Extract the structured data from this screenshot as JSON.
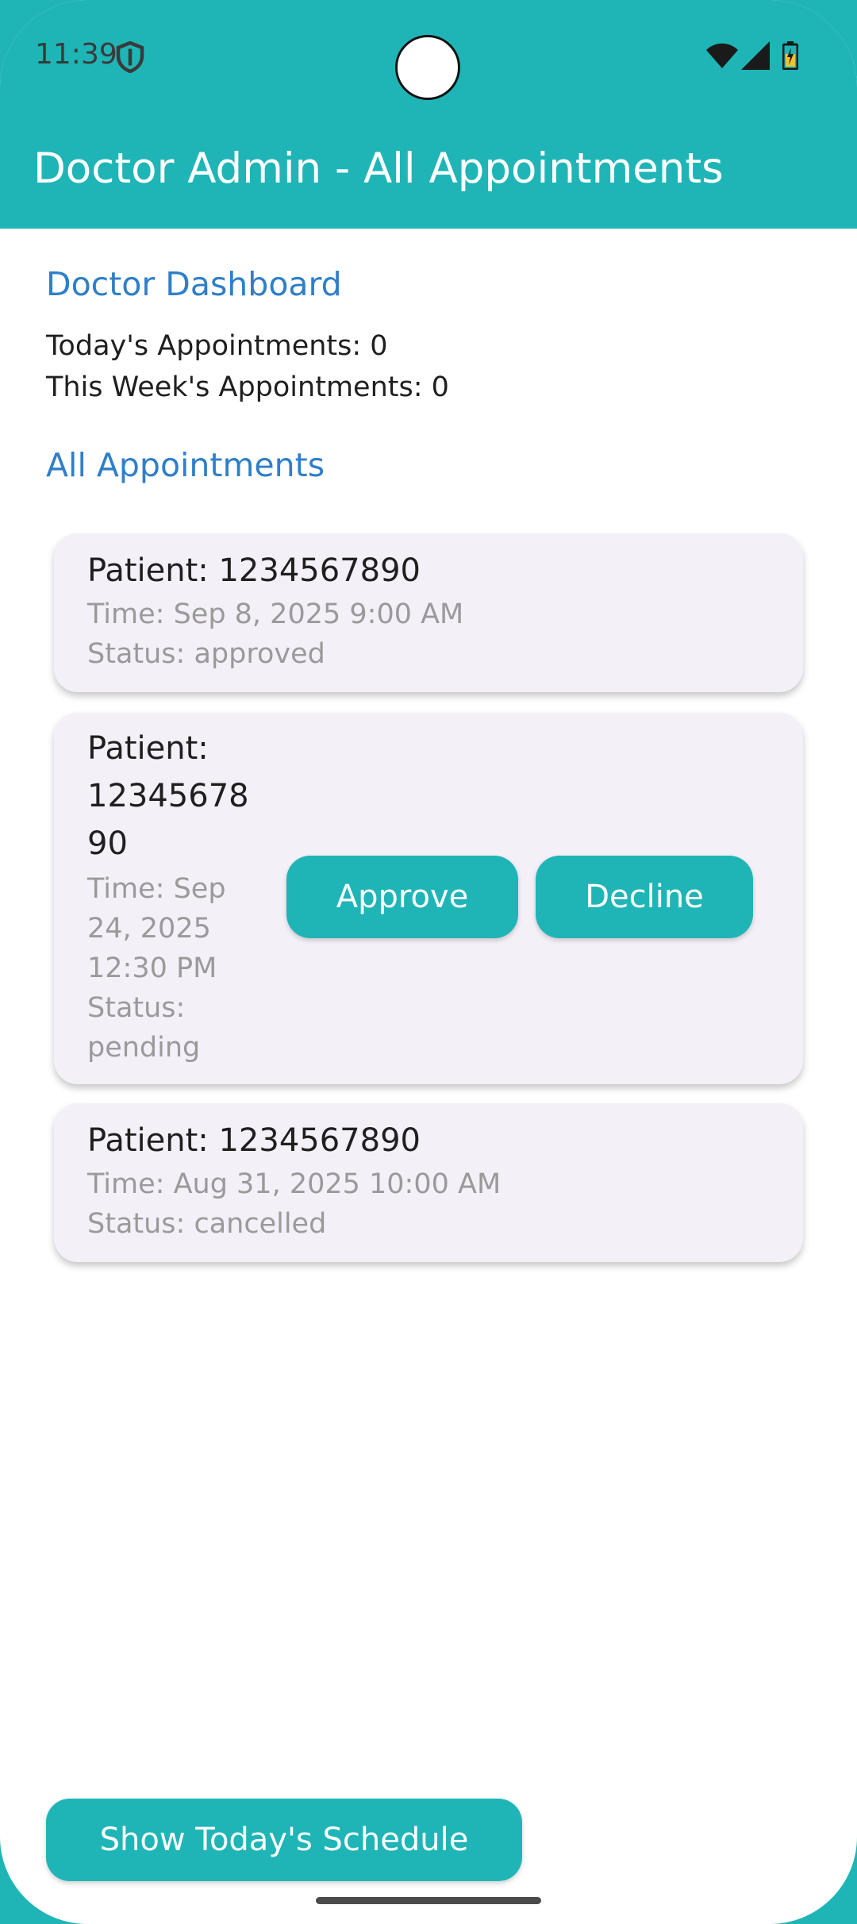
{
  "status_bar": {
    "time": "11:39",
    "icons": [
      "shield-icon",
      "wifi-icon",
      "signal-icon",
      "battery-icon"
    ]
  },
  "app_bar": {
    "title": "Doctor Admin - All Appointments"
  },
  "dashboard": {
    "heading": "Doctor Dashboard",
    "today_count": "Today's Appointments: 0",
    "week_count": "This Week's Appointments: 0"
  },
  "appointments": {
    "heading": "All Appointments",
    "items": [
      {
        "patient": "Patient: 1234567890",
        "time": "Time: Sep 8, 2025 9:00 AM",
        "status": "Status: approved"
      },
      {
        "patient_lines": [
          "Patient:",
          "12345678",
          "90"
        ],
        "time_lines": [
          "Time: Sep",
          "24, 2025",
          "12:30 PM"
        ],
        "status_lines": [
          "Status:",
          "pending"
        ],
        "approve_label": "Approve",
        "decline_label": "Decline"
      },
      {
        "patient": "Patient: 1234567890",
        "time": "Time: Aug 31, 2025 10:00 AM",
        "status": "Status: cancelled"
      }
    ]
  },
  "footer": {
    "schedule_button": "Show Today's Schedule"
  },
  "colors": {
    "accent": "#1fb5b7",
    "link": "#2f7fc8",
    "card": "#f4f0f8"
  }
}
